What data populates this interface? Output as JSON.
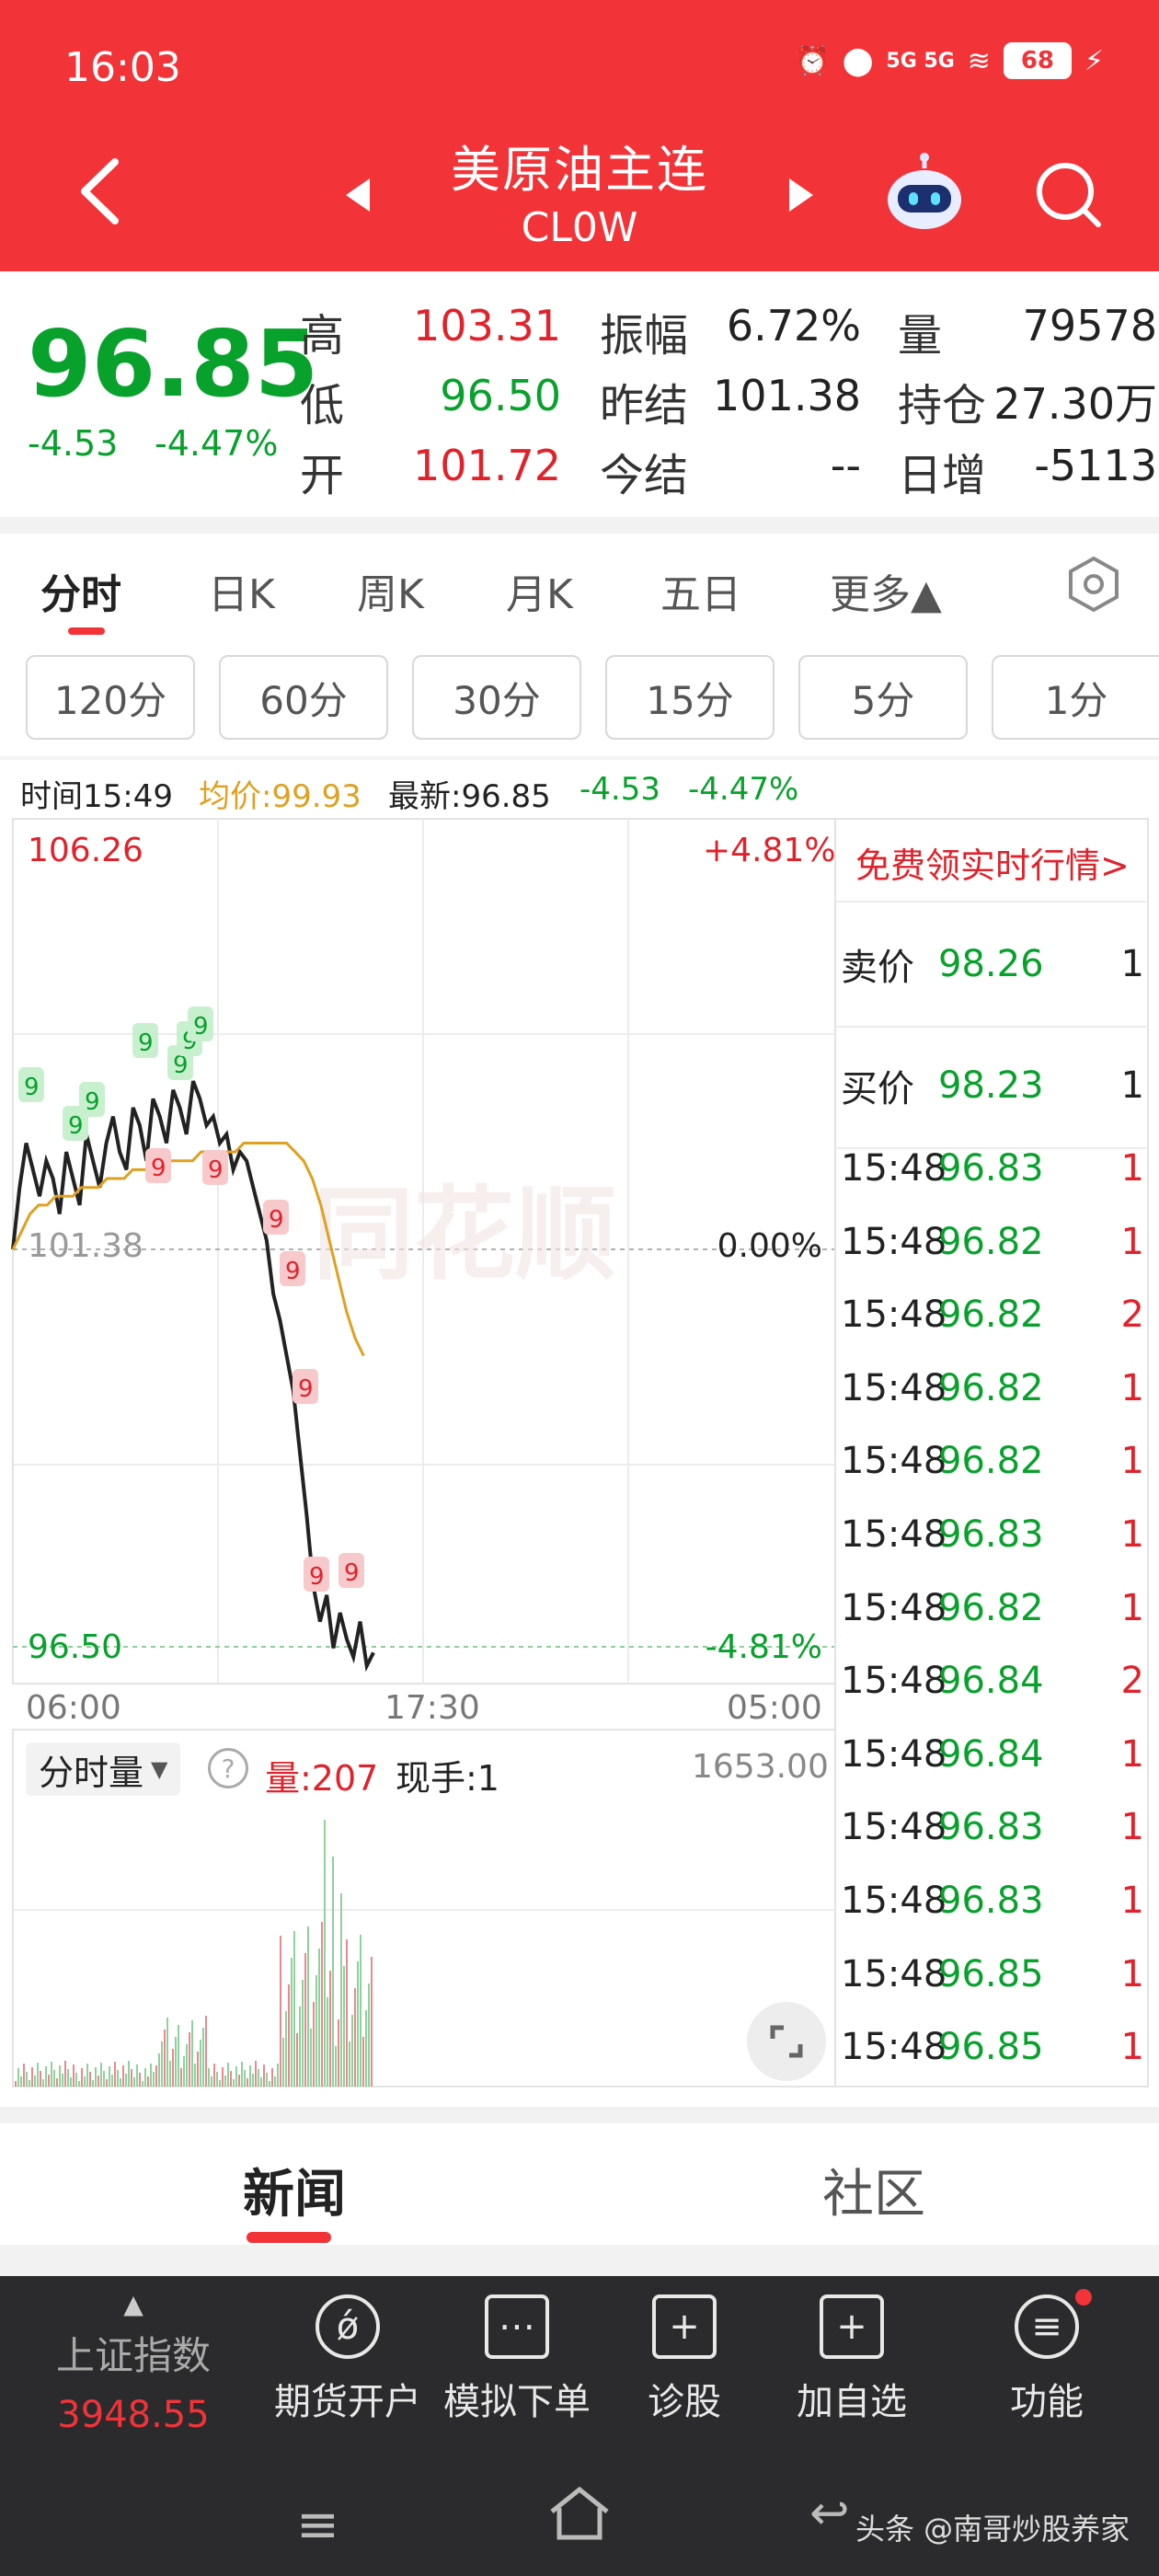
{
  "status_bar": {
    "time": "16:03",
    "network": "5G 5G",
    "battery": "68"
  },
  "header": {
    "title": "美原油主连",
    "subtitle": "CL0W"
  },
  "quote": {
    "price": "96.85",
    "change": "-4.53",
    "change_pct": "-4.47%",
    "high_label": "高",
    "high": "103.31",
    "low_label": "低",
    "low": "96.50",
    "open_label": "开",
    "open": "101.72",
    "amplitude_label": "振幅",
    "amplitude": "6.72%",
    "prev_settle_label": "昨结",
    "prev_settle": "101.38",
    "settle_label": "今结",
    "settle": "--",
    "volume_label": "量",
    "volume": "79578",
    "open_interest_label": "持仓",
    "open_interest": "27.30万",
    "daily_increase_label": "日增",
    "daily_increase": "-5113"
  },
  "chart_tabs": [
    "分时",
    "日K",
    "周K",
    "月K",
    "五日",
    "更多▲"
  ],
  "minute_tabs": [
    "120分",
    "60分",
    "30分",
    "15分",
    "5分",
    "1分"
  ],
  "info_line": {
    "time": "时间15:49",
    "avg": "均价:99.93",
    "latest": "最新:96.85",
    "change": "-4.53",
    "change_pct": "-4.47%"
  },
  "chart_axis": {
    "top_price": "106.26",
    "top_pct": "+4.81%",
    "mid_price": "101.38",
    "mid_pct": "0.00%",
    "bottom_price": "96.50",
    "bottom_pct": "-4.81%",
    "x_start": "06:00",
    "x_mid": "17:30",
    "x_end": "05:00"
  },
  "volume_panel": {
    "selector": "分时量",
    "vol_label": "量:207",
    "hand_label": "现手:1",
    "max": "1653.00"
  },
  "promo": "免费领实时行情>",
  "order_book": {
    "ask_label": "卖价",
    "ask_price": "98.26",
    "ask_vol": "1",
    "bid_label": "买价",
    "bid_price": "98.23",
    "bid_vol": "1",
    "ticks": [
      {
        "time": "15:48",
        "price": "96.83",
        "vol": "1"
      },
      {
        "time": "15:48",
        "price": "96.82",
        "vol": "1"
      },
      {
        "time": "15:48",
        "price": "96.82",
        "vol": "2"
      },
      {
        "time": "15:48",
        "price": "96.82",
        "vol": "1"
      },
      {
        "time": "15:48",
        "price": "96.82",
        "vol": "1"
      },
      {
        "time": "15:48",
        "price": "96.83",
        "vol": "1"
      },
      {
        "time": "15:48",
        "price": "96.82",
        "vol": "1"
      },
      {
        "time": "15:48",
        "price": "96.84",
        "vol": "2"
      },
      {
        "time": "15:48",
        "price": "96.84",
        "vol": "1"
      },
      {
        "time": "15:48",
        "price": "96.83",
        "vol": "1"
      },
      {
        "time": "15:48",
        "price": "96.83",
        "vol": "1"
      },
      {
        "time": "15:48",
        "price": "96.85",
        "vol": "1"
      },
      {
        "time": "15:48",
        "price": "96.85",
        "vol": "1"
      }
    ]
  },
  "news_tabs": [
    "新闻",
    "社区"
  ],
  "bottom_nav": {
    "index_name": "上证指数",
    "index_value": "3948.55",
    "items": [
      "期货开户",
      "模拟下单",
      "诊股",
      "加自选",
      "功能"
    ]
  },
  "watermark": "头条 @南哥炒股养家",
  "colors": {
    "brand": "#f23338",
    "up": "#e0232b",
    "down": "#08a12c",
    "avg_line": "#e0a020"
  }
}
